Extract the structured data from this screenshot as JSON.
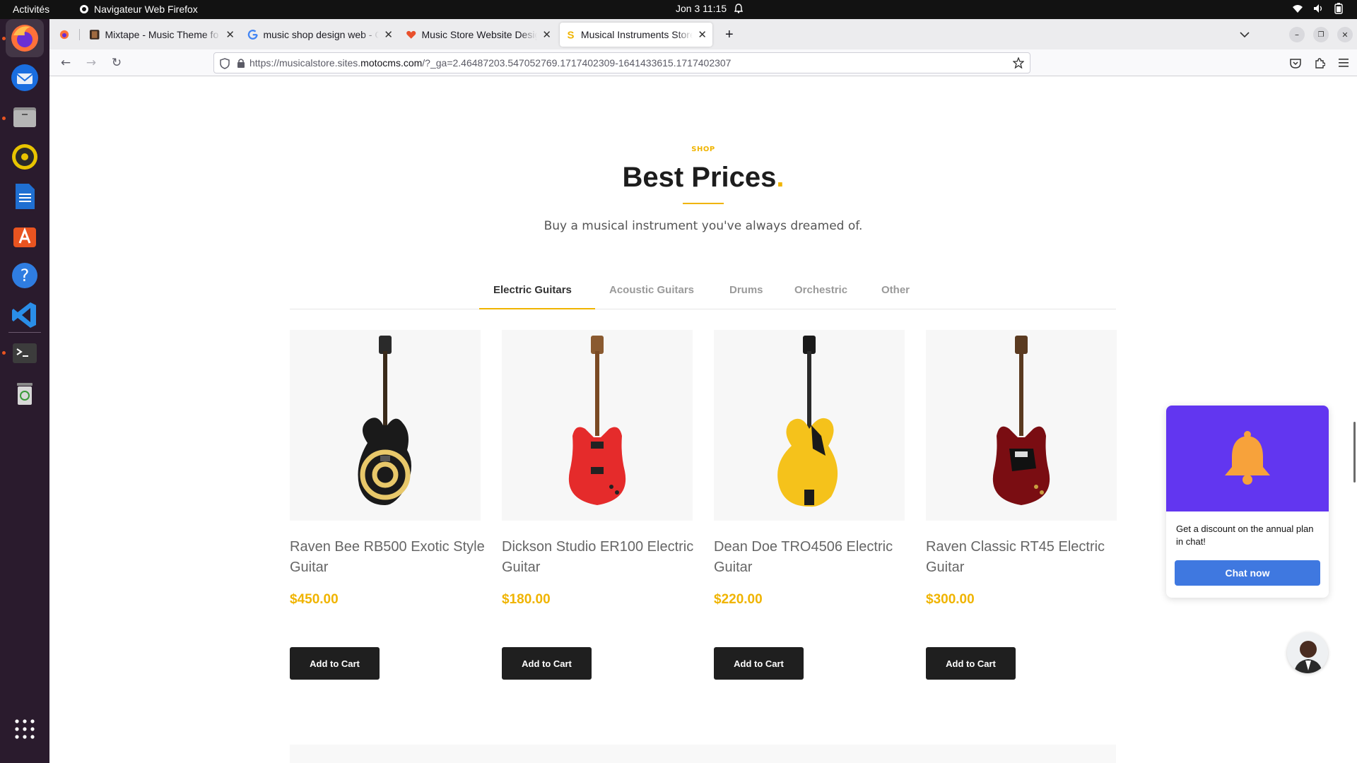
{
  "topbar": {
    "activities": "Activités",
    "app_name": "Navigateur Web Firefox",
    "clock": "Jon 3  11:15"
  },
  "dock": {
    "items": [
      "firefox",
      "thunderbird",
      "files",
      "rhythmbox",
      "writer",
      "app-center",
      "help",
      "vscode",
      "terminal",
      "trash",
      "show-apps"
    ]
  },
  "browser": {
    "tabs": [
      {
        "title": "Mixtape - Music Theme fo"
      },
      {
        "title": "music shop design web - G"
      },
      {
        "title": "Music Store Website Desig"
      },
      {
        "title": "Musical Instruments Store"
      }
    ],
    "url_prefix": "https://musicalstore.sites.",
    "url_domain": "motocms.com",
    "url_suffix": "/?_ga=2.46487203.547052769.1717402309-1641433615.1717402307"
  },
  "section": {
    "eyebrow": "SHOP",
    "title": "Best Prices",
    "title_dot": ".",
    "subtitle": "Buy a musical instrument you've always dreamed of."
  },
  "categories": [
    "Electric Guitars",
    "Acoustic Guitars",
    "Drums",
    "Orchestric",
    "Other"
  ],
  "active_category": "Electric Guitars",
  "products": [
    {
      "name": "Raven Bee RB500 Exotic Style Guitar",
      "price": "$450.00",
      "button": "Add to Cart",
      "color": "#1a1a1a"
    },
    {
      "name": "Dickson Studio ER100 Electric Guitar",
      "price": "$180.00",
      "button": "Add to Cart",
      "color": "#e52b2b"
    },
    {
      "name": "Dean Doe TRO4506 Electric Guitar",
      "price": "$220.00",
      "button": "Add to Cart",
      "color": "#f5c21b"
    },
    {
      "name": "Raven Classic RT45 Electric Guitar",
      "price": "$300.00",
      "button": "Add to Cart",
      "color": "#7a0d12"
    }
  ],
  "chat": {
    "message": "Get a discount on the annual plan in chat!",
    "button": "Chat now"
  },
  "colors": {
    "accent": "#f0b400",
    "chat_banner": "#6236f0",
    "chat_button": "#3f78e0"
  }
}
